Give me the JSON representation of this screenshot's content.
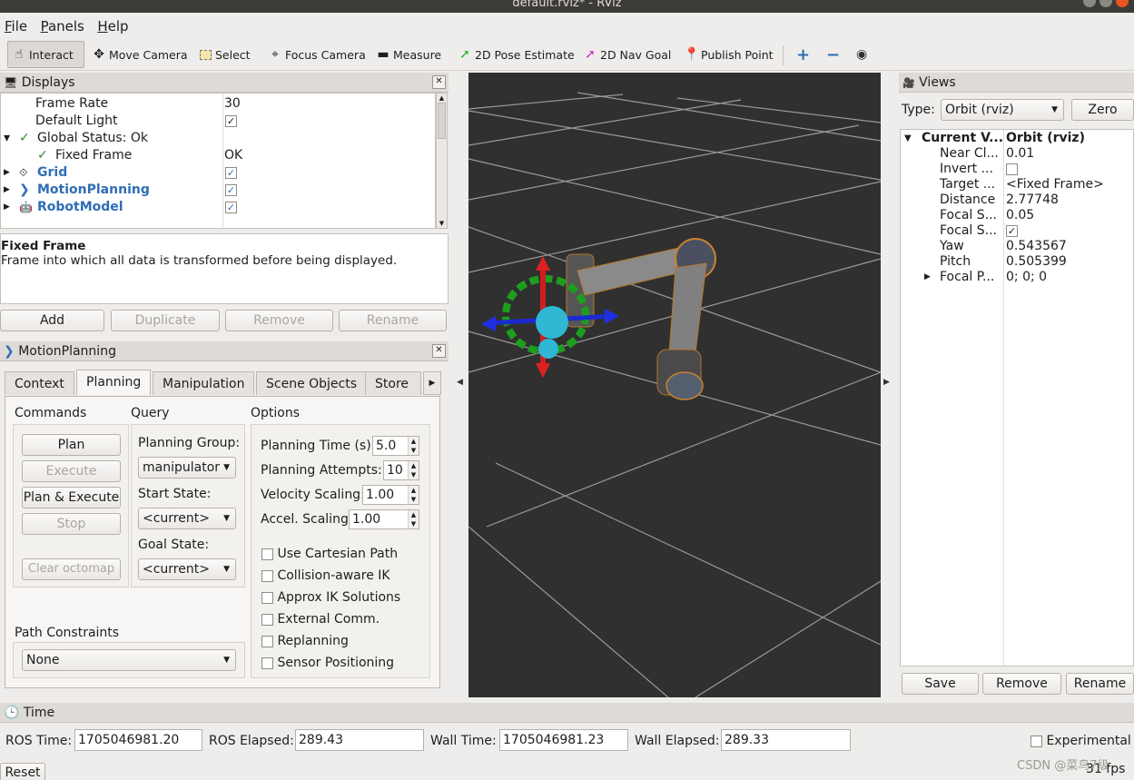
{
  "window": {
    "title": "default.rviz* - RViz"
  },
  "menubar": {
    "items": [
      "File",
      "Panels",
      "Help"
    ]
  },
  "toolbar": {
    "interact": "Interact",
    "move_camera": "Move Camera",
    "select": "Select",
    "focus_camera": "Focus Camera",
    "measure": "Measure",
    "pose_estimate": "2D Pose Estimate",
    "nav_goal": "2D Nav Goal",
    "publish_point": "Publish Point",
    "colors": {
      "pose": "#22b522",
      "nav": "#d025c7",
      "point": "#d23b2a",
      "plus": "#2f6db5"
    }
  },
  "displays": {
    "title": "Displays",
    "rows": {
      "frame_rate": {
        "label": "Frame Rate",
        "value": "30"
      },
      "default_light": {
        "label": "Default Light"
      },
      "global_status": {
        "label": "Global Status: Ok"
      },
      "fixed_frame": {
        "label": "Fixed Frame",
        "value": "OK"
      },
      "grid": {
        "label": "Grid"
      },
      "motion_planning": {
        "label": "MotionPlanning"
      },
      "robot_model": {
        "label": "RobotModel"
      }
    },
    "desc_title": "Fixed Frame",
    "desc_text": "Frame into which all data is transformed before being displayed.",
    "buttons": {
      "add": "Add",
      "duplicate": "Duplicate",
      "remove": "Remove",
      "rename": "Rename"
    }
  },
  "motion_planning": {
    "title": "MotionPlanning",
    "tabs": [
      "Context",
      "Planning",
      "Manipulation",
      "Scene Objects",
      "Store"
    ],
    "commands": {
      "title": "Commands",
      "plan": "Plan",
      "execute": "Execute",
      "plan_execute": "Plan & Execute",
      "stop": "Stop",
      "clear_octomap": "Clear octomap"
    },
    "query": {
      "title": "Query",
      "planning_group_label": "Planning Group:",
      "planning_group": "manipulator",
      "start_state_label": "Start State:",
      "start_state": "<current>",
      "goal_state_label": "Goal State:",
      "goal_state": "<current>"
    },
    "options": {
      "title": "Options",
      "planning_time_label": "Planning Time (s):",
      "planning_time": "5.0",
      "planning_attempts_label": "Planning Attempts:",
      "planning_attempts": "10",
      "velocity_scaling_label": "Velocity Scaling:",
      "velocity_scaling": "1.00",
      "accel_scaling_label": "Accel. Scaling:",
      "accel_scaling": "1.00",
      "checks": [
        "Use Cartesian Path",
        "Collision-aware IK",
        "Approx IK Solutions",
        "External Comm.",
        "Replanning",
        "Sensor Positioning"
      ]
    },
    "path_constraints": {
      "title": "Path Constraints",
      "value": "None"
    }
  },
  "views": {
    "title": "Views",
    "type_label": "Type:",
    "type_value": "Orbit (rviz)",
    "zero": "Zero",
    "header": {
      "name": "Current V...",
      "value": "Orbit (rviz)"
    },
    "props": [
      {
        "name": "Near Cl...",
        "value": "0.01"
      },
      {
        "name": "Invert ...",
        "value": ""
      },
      {
        "name": "Target ...",
        "value": "<Fixed Frame>"
      },
      {
        "name": "Distance",
        "value": "2.77748"
      },
      {
        "name": "Focal S...",
        "value": "0.05"
      },
      {
        "name": "Focal S...",
        "value": ""
      },
      {
        "name": "Yaw",
        "value": "0.543567"
      },
      {
        "name": "Pitch",
        "value": "0.505399"
      },
      {
        "name": "Focal P...",
        "value": "0; 0; 0"
      }
    ],
    "buttons": {
      "save": "Save",
      "remove": "Remove",
      "rename": "Rename"
    }
  },
  "time": {
    "title": "Time",
    "ros_time_label": "ROS Time:",
    "ros_time": "1705046981.20",
    "ros_elapsed_label": "ROS Elapsed:",
    "ros_elapsed": "289.43",
    "wall_time_label": "Wall Time:",
    "wall_time": "1705046981.23",
    "wall_elapsed_label": "Wall Elapsed:",
    "wall_elapsed": "289.33",
    "experimental": "Experimental",
    "reset": "Reset",
    "fps": "31 fps"
  },
  "watermark": "CSDN @菜鸟7级"
}
